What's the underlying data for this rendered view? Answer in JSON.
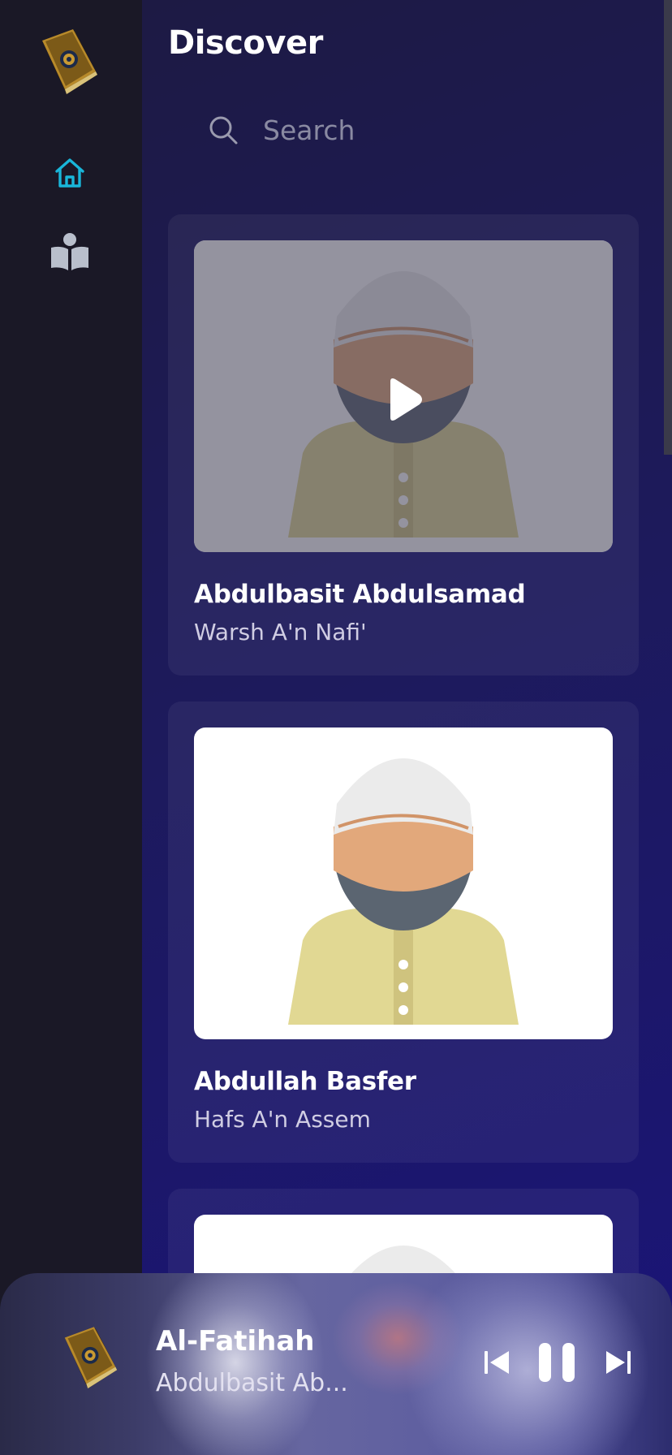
{
  "colors": {
    "accent": "#19b6d9",
    "sidebar_bg": "#1a1826",
    "main_bg": "#1d1a5c",
    "text_primary": "#ffffff",
    "text_secondary": "#d0cde3",
    "beard": "#5b6571",
    "cap": "#ebebeb",
    "face": "#e2a87b",
    "robe": "#e1d893"
  },
  "sidebar": {
    "logo_icon": "quran-book-icon",
    "items": [
      {
        "name": "home",
        "icon": "home-icon",
        "active": true
      },
      {
        "name": "reading",
        "icon": "reading-book-icon",
        "active": false
      }
    ]
  },
  "header": {
    "title": "Discover"
  },
  "search": {
    "placeholder": "Search",
    "icon": "search-icon"
  },
  "reciters": [
    {
      "name": "Abdulbasit Abdulsamad",
      "riwaya": "Warsh A'n Nafi'",
      "playing": true
    },
    {
      "name": "Abdullah Basfer",
      "riwaya": "Hafs A'n Assem",
      "playing": false
    },
    {
      "name": "",
      "riwaya": "",
      "playing": false
    }
  ],
  "player": {
    "title": "Al-Fatihah",
    "artist": "Abdulbasit Ab...",
    "cover_icon": "quran-book-icon",
    "controls": {
      "prev_icon": "skip-previous-icon",
      "pause_icon": "pause-icon",
      "next_icon": "skip-next-icon"
    }
  }
}
